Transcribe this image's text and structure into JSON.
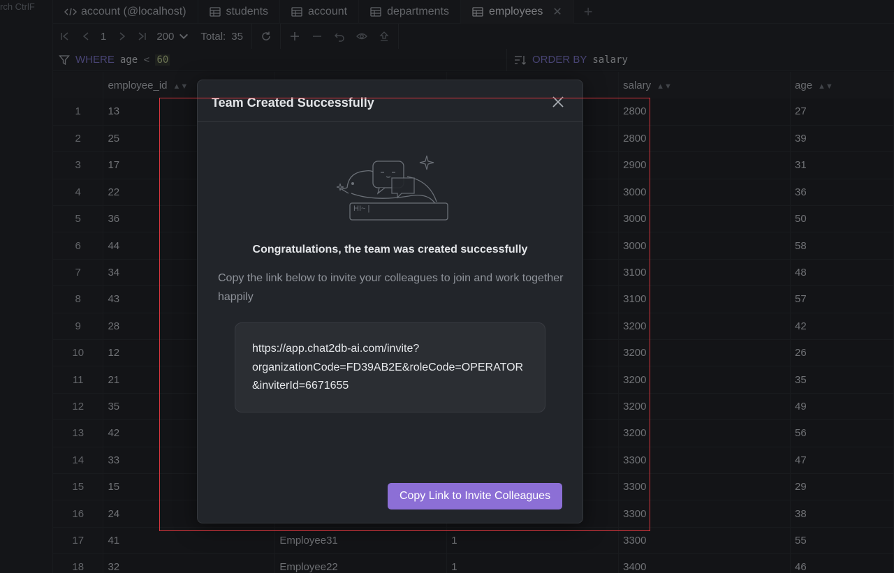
{
  "sidebar": {
    "search_hint": "rch  CtrlF"
  },
  "tabs": [
    {
      "label": "account (@localhost)",
      "icon": "code-icon"
    },
    {
      "label": "students",
      "icon": "table-icon"
    },
    {
      "label": "account",
      "icon": "table-icon"
    },
    {
      "label": "departments",
      "icon": "table-icon"
    },
    {
      "label": "employees",
      "icon": "table-icon",
      "active": true
    }
  ],
  "toolbar": {
    "page": "1",
    "page_size": "200",
    "total_label": "Total:",
    "total_value": "35"
  },
  "filter": {
    "where_label": "WHERE",
    "where_field": "age",
    "where_op": "<",
    "where_value": "60",
    "order_label": "ORDER BY",
    "order_field": "salary"
  },
  "grid": {
    "columns": [
      "employee_id",
      "",
      "",
      "salary",
      "age"
    ],
    "rows": [
      [
        "1",
        "13",
        "",
        "",
        "2800",
        "27"
      ],
      [
        "2",
        "25",
        "",
        "",
        "2800",
        "39"
      ],
      [
        "3",
        "17",
        "",
        "",
        "2900",
        "31"
      ],
      [
        "4",
        "22",
        "",
        "",
        "3000",
        "36"
      ],
      [
        "5",
        "36",
        "",
        "",
        "3000",
        "50"
      ],
      [
        "6",
        "44",
        "",
        "",
        "3000",
        "58"
      ],
      [
        "7",
        "34",
        "",
        "",
        "3100",
        "48"
      ],
      [
        "8",
        "43",
        "",
        "",
        "3100",
        "57"
      ],
      [
        "9",
        "28",
        "",
        "",
        "3200",
        "42"
      ],
      [
        "10",
        "12",
        "",
        "",
        "3200",
        "26"
      ],
      [
        "11",
        "21",
        "",
        "",
        "3200",
        "35"
      ],
      [
        "12",
        "35",
        "",
        "",
        "3200",
        "49"
      ],
      [
        "13",
        "42",
        "",
        "",
        "3200",
        "56"
      ],
      [
        "14",
        "33",
        "",
        "",
        "3300",
        "47"
      ],
      [
        "15",
        "15",
        "",
        "",
        "3300",
        "29"
      ],
      [
        "16",
        "24",
        "",
        "",
        "3300",
        "38"
      ],
      [
        "17",
        "41",
        "Employee31",
        "1",
        "3300",
        "55"
      ],
      [
        "18",
        "32",
        "Employee22",
        "1",
        "3400",
        "46"
      ]
    ]
  },
  "modal": {
    "title": "Team Created Successfully",
    "illustration_text": "HI~ |",
    "congrats": "Congratulations, the team was created successfully",
    "description": "Copy the link below to invite your colleagues to join and work together happily",
    "link_line1": "https://app.chat2db-ai.com/invite?",
    "link_line2": "organizationCode=FD39AB2E&roleCode=OPERATOR",
    "link_line3": "&inviterId=6671655",
    "copy_button": "Copy Link to Invite Colleagues"
  },
  "colors": {
    "accent": "#8c6fd6",
    "keyword": "#7a73c9",
    "highlight": "#d9363e"
  }
}
